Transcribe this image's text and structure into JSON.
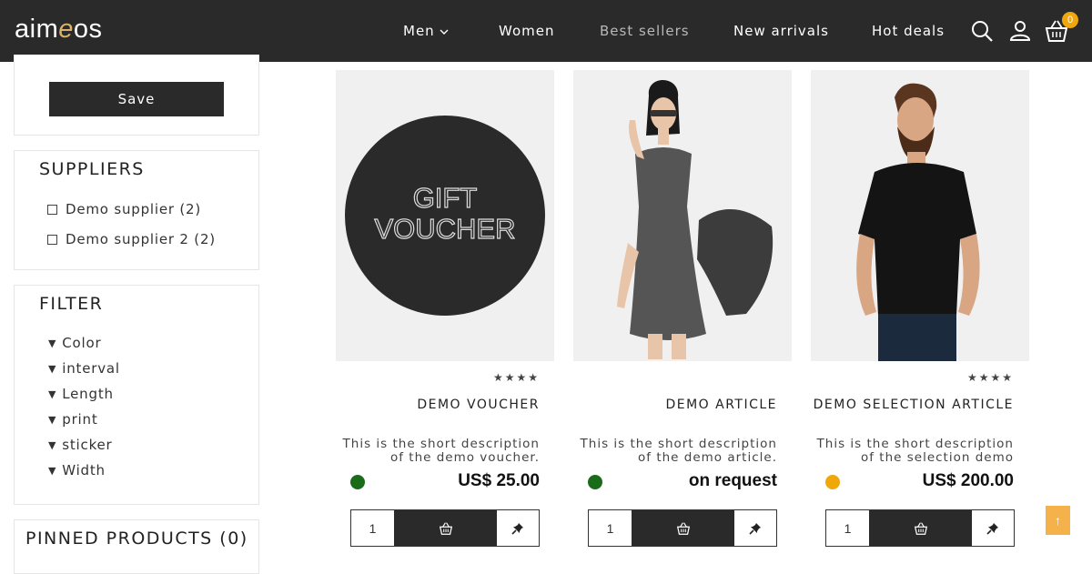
{
  "header": {
    "logo_prefix": "aim",
    "logo_accent": "e",
    "logo_suffix": "os",
    "nav": [
      {
        "label": "Men"
      },
      {
        "label": "Women"
      },
      {
        "label": "Best sellers"
      },
      {
        "label": "New arrivals"
      },
      {
        "label": "Hot deals"
      }
    ],
    "cart_count": "0",
    "icons": [
      "search-icon",
      "user-icon",
      "basket-icon"
    ]
  },
  "sidebar": {
    "save_label": "Save",
    "suppliers": {
      "title": "SUPPLIERS",
      "items": [
        {
          "label": "Demo supplier (2)"
        },
        {
          "label": "Demo supplier 2 (2)"
        }
      ]
    },
    "filter": {
      "title": "FILTER",
      "items": [
        {
          "label": "Color"
        },
        {
          "label": "interval"
        },
        {
          "label": "Length"
        },
        {
          "label": "print"
        },
        {
          "label": "sticker"
        },
        {
          "label": "Width"
        }
      ]
    },
    "pinned": {
      "title": "PINNED PRODUCTS (0)"
    }
  },
  "products": [
    {
      "image_text_1": "GIFT",
      "image_text_2": "VOUCHER",
      "stars": "★★★★",
      "name": "DEMO VOUCHER",
      "desc_line1": "This is the short description",
      "desc_line2": "of the demo voucher.",
      "price": "US$ 25.00",
      "stock_color": "#1a6b1a",
      "qty": "1"
    },
    {
      "stars": "",
      "name": "DEMO ARTICLE",
      "desc_line1": "This is the short description",
      "desc_line2": "of the demo article.",
      "price": "on request",
      "stock_color": "#1a6b1a",
      "qty": "1"
    },
    {
      "stars": "★★★★",
      "name": "DEMO SELECTION ARTICLE",
      "desc_line1": "This is the short description",
      "desc_line2": "of the selection demo",
      "price": "US$ 200.00",
      "stock_color": "#f0a70a",
      "qty": "1"
    }
  ],
  "colors": {
    "header_bg": "#2a2a2a",
    "accent": "#f0a70a",
    "back_to_top": "#f5b14a"
  },
  "back_to_top_icon": "arrow-up-icon"
}
